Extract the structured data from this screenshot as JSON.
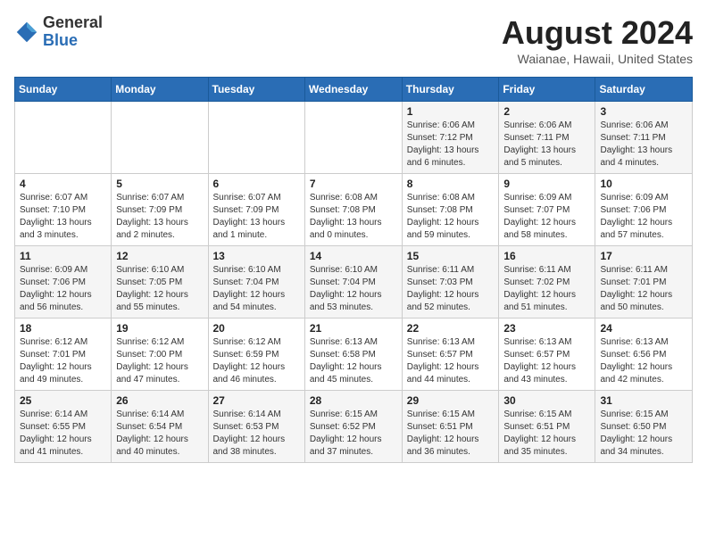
{
  "header": {
    "logo_general": "General",
    "logo_blue": "Blue",
    "month_year": "August 2024",
    "location": "Waianae, Hawaii, United States"
  },
  "days_of_week": [
    "Sunday",
    "Monday",
    "Tuesday",
    "Wednesday",
    "Thursday",
    "Friday",
    "Saturday"
  ],
  "weeks": [
    [
      {
        "day": "",
        "info": ""
      },
      {
        "day": "",
        "info": ""
      },
      {
        "day": "",
        "info": ""
      },
      {
        "day": "",
        "info": ""
      },
      {
        "day": "1",
        "info": "Sunrise: 6:06 AM\nSunset: 7:12 PM\nDaylight: 13 hours\nand 6 minutes."
      },
      {
        "day": "2",
        "info": "Sunrise: 6:06 AM\nSunset: 7:11 PM\nDaylight: 13 hours\nand 5 minutes."
      },
      {
        "day": "3",
        "info": "Sunrise: 6:06 AM\nSunset: 7:11 PM\nDaylight: 13 hours\nand 4 minutes."
      }
    ],
    [
      {
        "day": "4",
        "info": "Sunrise: 6:07 AM\nSunset: 7:10 PM\nDaylight: 13 hours\nand 3 minutes."
      },
      {
        "day": "5",
        "info": "Sunrise: 6:07 AM\nSunset: 7:09 PM\nDaylight: 13 hours\nand 2 minutes."
      },
      {
        "day": "6",
        "info": "Sunrise: 6:07 AM\nSunset: 7:09 PM\nDaylight: 13 hours\nand 1 minute."
      },
      {
        "day": "7",
        "info": "Sunrise: 6:08 AM\nSunset: 7:08 PM\nDaylight: 13 hours\nand 0 minutes."
      },
      {
        "day": "8",
        "info": "Sunrise: 6:08 AM\nSunset: 7:08 PM\nDaylight: 12 hours\nand 59 minutes."
      },
      {
        "day": "9",
        "info": "Sunrise: 6:09 AM\nSunset: 7:07 PM\nDaylight: 12 hours\nand 58 minutes."
      },
      {
        "day": "10",
        "info": "Sunrise: 6:09 AM\nSunset: 7:06 PM\nDaylight: 12 hours\nand 57 minutes."
      }
    ],
    [
      {
        "day": "11",
        "info": "Sunrise: 6:09 AM\nSunset: 7:06 PM\nDaylight: 12 hours\nand 56 minutes."
      },
      {
        "day": "12",
        "info": "Sunrise: 6:10 AM\nSunset: 7:05 PM\nDaylight: 12 hours\nand 55 minutes."
      },
      {
        "day": "13",
        "info": "Sunrise: 6:10 AM\nSunset: 7:04 PM\nDaylight: 12 hours\nand 54 minutes."
      },
      {
        "day": "14",
        "info": "Sunrise: 6:10 AM\nSunset: 7:04 PM\nDaylight: 12 hours\nand 53 minutes."
      },
      {
        "day": "15",
        "info": "Sunrise: 6:11 AM\nSunset: 7:03 PM\nDaylight: 12 hours\nand 52 minutes."
      },
      {
        "day": "16",
        "info": "Sunrise: 6:11 AM\nSunset: 7:02 PM\nDaylight: 12 hours\nand 51 minutes."
      },
      {
        "day": "17",
        "info": "Sunrise: 6:11 AM\nSunset: 7:01 PM\nDaylight: 12 hours\nand 50 minutes."
      }
    ],
    [
      {
        "day": "18",
        "info": "Sunrise: 6:12 AM\nSunset: 7:01 PM\nDaylight: 12 hours\nand 49 minutes."
      },
      {
        "day": "19",
        "info": "Sunrise: 6:12 AM\nSunset: 7:00 PM\nDaylight: 12 hours\nand 47 minutes."
      },
      {
        "day": "20",
        "info": "Sunrise: 6:12 AM\nSunset: 6:59 PM\nDaylight: 12 hours\nand 46 minutes."
      },
      {
        "day": "21",
        "info": "Sunrise: 6:13 AM\nSunset: 6:58 PM\nDaylight: 12 hours\nand 45 minutes."
      },
      {
        "day": "22",
        "info": "Sunrise: 6:13 AM\nSunset: 6:57 PM\nDaylight: 12 hours\nand 44 minutes."
      },
      {
        "day": "23",
        "info": "Sunrise: 6:13 AM\nSunset: 6:57 PM\nDaylight: 12 hours\nand 43 minutes."
      },
      {
        "day": "24",
        "info": "Sunrise: 6:13 AM\nSunset: 6:56 PM\nDaylight: 12 hours\nand 42 minutes."
      }
    ],
    [
      {
        "day": "25",
        "info": "Sunrise: 6:14 AM\nSunset: 6:55 PM\nDaylight: 12 hours\nand 41 minutes."
      },
      {
        "day": "26",
        "info": "Sunrise: 6:14 AM\nSunset: 6:54 PM\nDaylight: 12 hours\nand 40 minutes."
      },
      {
        "day": "27",
        "info": "Sunrise: 6:14 AM\nSunset: 6:53 PM\nDaylight: 12 hours\nand 38 minutes."
      },
      {
        "day": "28",
        "info": "Sunrise: 6:15 AM\nSunset: 6:52 PM\nDaylight: 12 hours\nand 37 minutes."
      },
      {
        "day": "29",
        "info": "Sunrise: 6:15 AM\nSunset: 6:51 PM\nDaylight: 12 hours\nand 36 minutes."
      },
      {
        "day": "30",
        "info": "Sunrise: 6:15 AM\nSunset: 6:51 PM\nDaylight: 12 hours\nand 35 minutes."
      },
      {
        "day": "31",
        "info": "Sunrise: 6:15 AM\nSunset: 6:50 PM\nDaylight: 12 hours\nand 34 minutes."
      }
    ]
  ]
}
